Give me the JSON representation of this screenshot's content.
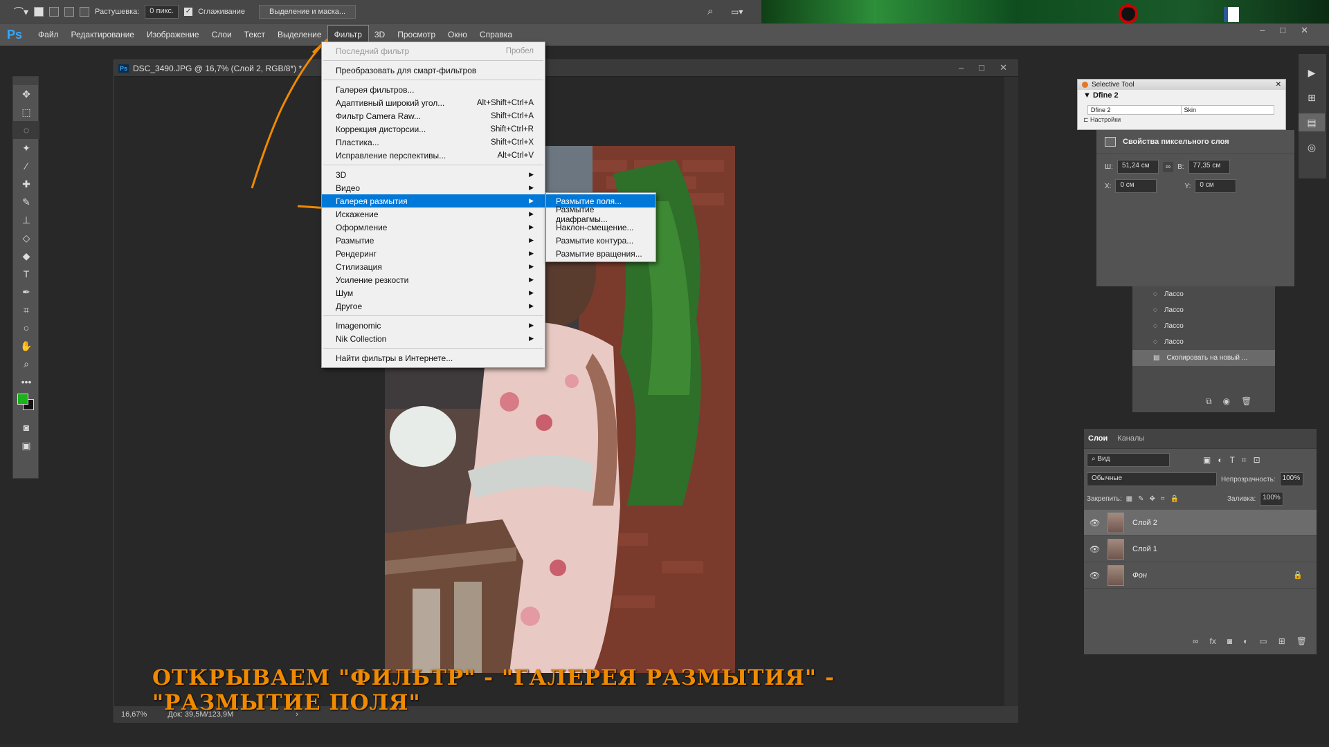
{
  "options_bar": {
    "feather_label": "Растушевка:",
    "feather_value": "0 пикс.",
    "antialias_label": "Сглаживание",
    "select_mask_button": "Выделение и маска..."
  },
  "menu_bar": {
    "logo": "Ps",
    "items": [
      "Файл",
      "Редактирование",
      "Изображение",
      "Слои",
      "Текст",
      "Выделение",
      "Фильтр",
      "3D",
      "Просмотр",
      "Окно",
      "Справка"
    ]
  },
  "document": {
    "tab_title": "DSC_3490.JPG @ 16,7% (Слой 2, RGB/8*) *",
    "zoom": "16,67%",
    "doc_info": "Док: 39,5M/123,9M"
  },
  "filter_menu": {
    "last_filter": "Последний фильтр",
    "last_filter_shortcut": "Пробел",
    "convert_smart": "Преобразовать для смарт-фильтров",
    "items_group1": [
      {
        "label": "Галерея фильтров...",
        "shortcut": ""
      },
      {
        "label": "Адаптивный широкий угол...",
        "shortcut": "Alt+Shift+Ctrl+A"
      },
      {
        "label": "Фильтр Camera Raw...",
        "shortcut": "Shift+Ctrl+A"
      },
      {
        "label": "Коррекция дисторсии...",
        "shortcut": "Shift+Ctrl+R"
      },
      {
        "label": "Пластика...",
        "shortcut": "Shift+Ctrl+X"
      },
      {
        "label": "Исправление перспективы...",
        "shortcut": "Alt+Ctrl+V"
      }
    ],
    "items_group2": [
      "3D",
      "Видео",
      "Галерея размытия",
      "Искажение",
      "Оформление",
      "Размытие",
      "Рендеринг",
      "Стилизация",
      "Усиление резкости",
      "Шум",
      "Другое"
    ],
    "items_group3": [
      "Imagenomic",
      "Nik Collection"
    ],
    "find_online": "Найти фильтры в Интернете..."
  },
  "blur_gallery_submenu": [
    "Размытие поля...",
    "Размытие диафрагмы...",
    "Наклон-смещение...",
    "Размытие контура...",
    "Размытие вращения..."
  ],
  "selective_tool": {
    "title": "Selective Tool",
    "item": "Dfine 2",
    "tab1": "Dfine 2",
    "tab2": "Skin",
    "settings": "Настройки"
  },
  "properties": {
    "title": "Свойства пиксельного слоя",
    "w_label": "Ш:",
    "w_value": "51,24 см",
    "h_label": "В:",
    "h_value": "77,35 см",
    "x_label": "X:",
    "x_value": "0 см",
    "y_label": "Y:",
    "y_value": "0 см"
  },
  "history": {
    "items": [
      "Лассо",
      "Лассо",
      "Лассо",
      "Лассо",
      "Скопировать на новый ..."
    ]
  },
  "layers": {
    "tab_layers": "Слои",
    "tab_channels": "Каналы",
    "filter_kind": "Вид",
    "blend_mode": "Обычные",
    "opacity_label": "Непрозрачность:",
    "opacity_value": "100%",
    "lock_label": "Закрепить:",
    "fill_label": "Заливка:",
    "fill_value": "100%",
    "items": [
      "Слой 2",
      "Слой 1",
      "Фон"
    ]
  },
  "caption": "ОТКРЫВАЕМ \"ФИЛЬТР\" - \"ГАЛЕРЕЯ РАЗМЫТИЯ\" - \"РАЗМЫТИЕ ПОЛЯ\"",
  "colors": {
    "accent_highlight": "#0078d7",
    "caption": "#f08a00",
    "foreground_swatch": "#1bb31b"
  }
}
